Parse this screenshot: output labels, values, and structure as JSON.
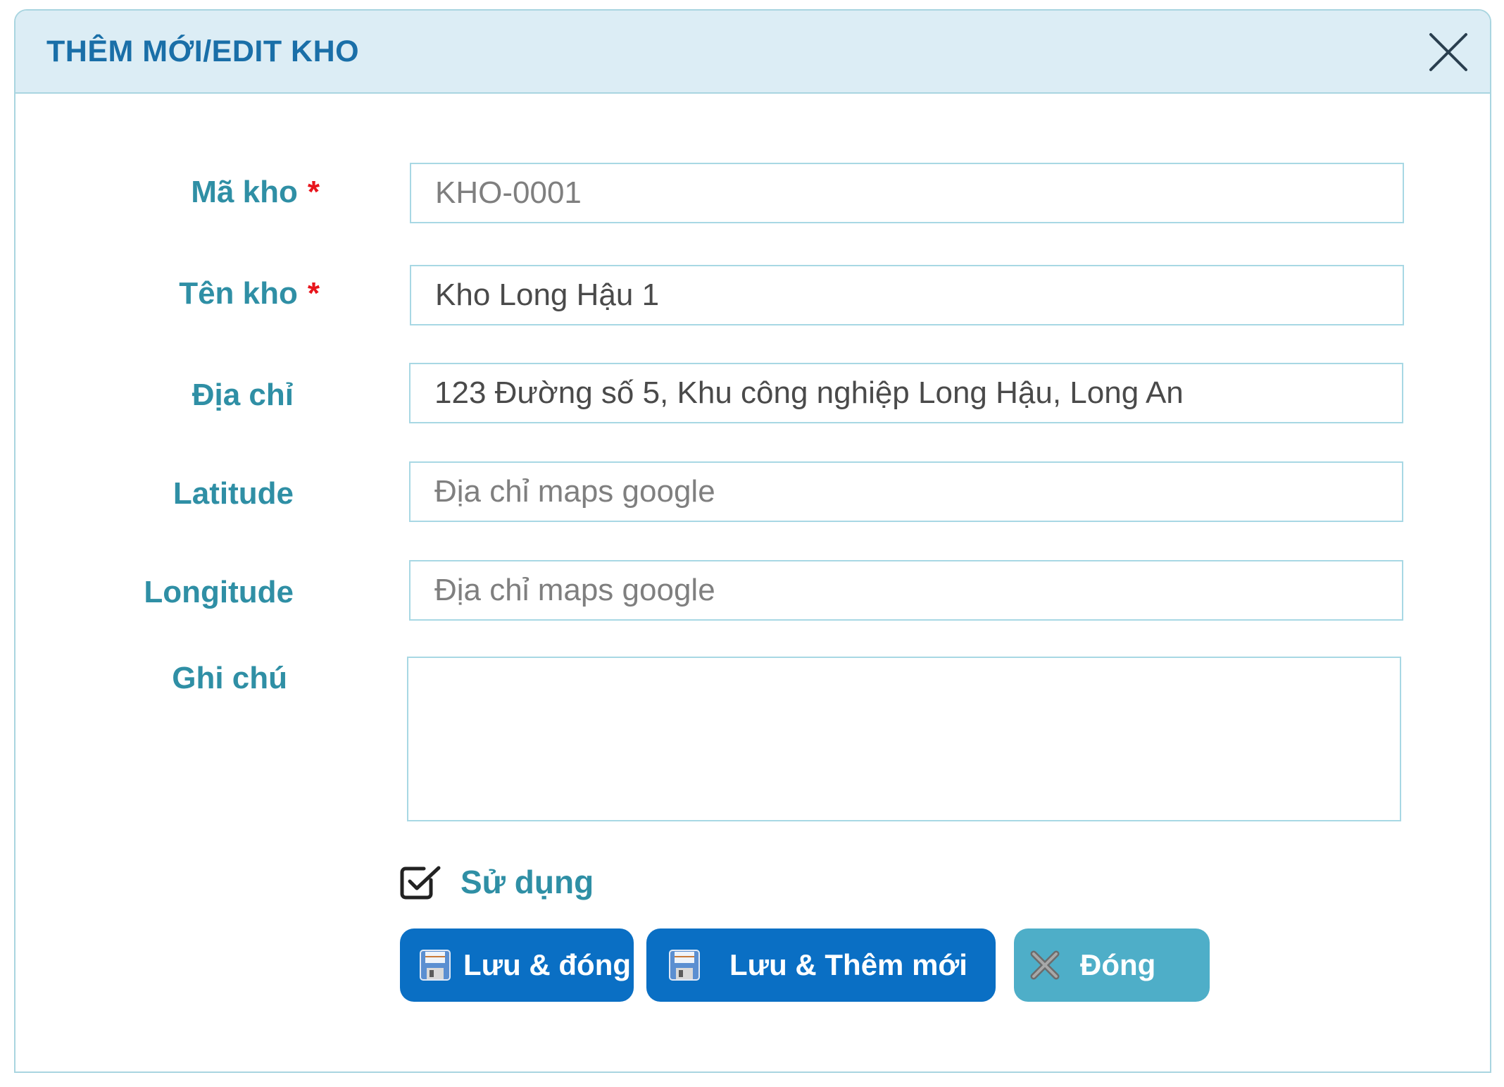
{
  "dialog": {
    "title": "THÊM MỚI/EDIT KHO",
    "close_icon": "close-icon"
  },
  "form": {
    "ma_kho": {
      "label": "Mã kho",
      "required_mark": "*",
      "value": "KHO-0001"
    },
    "ten_kho": {
      "label": "Tên kho",
      "required_mark": "*",
      "value": "Kho Long Hậu 1"
    },
    "dia_chi": {
      "label": "Địa chỉ",
      "value": "123 Đường số 5, Khu công nghiệp Long Hậu, Long An"
    },
    "latitude": {
      "label": "Latitude",
      "placeholder": "Địa chỉ maps google"
    },
    "longitude": {
      "label": "Longitude",
      "placeholder": "Địa chỉ maps google"
    },
    "ghi_chu": {
      "label": "Ghi chú",
      "value": ""
    },
    "su_dung": {
      "label": "Sử dụng",
      "checked": true,
      "icon": "checkbox-checked-icon"
    }
  },
  "buttons": {
    "save_close": {
      "label": "Lưu & đóng",
      "icon": "floppy-disk-icon"
    },
    "save_new": {
      "label": "Lưu & Thêm mới",
      "icon": "floppy-disk-icon"
    },
    "close": {
      "label": "Đóng",
      "icon": "x-icon"
    }
  },
  "colors": {
    "header_bg": "#dcedf5",
    "title": "#1a6fa8",
    "label": "#2f8fa5",
    "required": "#e8151c",
    "field_border": "#a8d8e4",
    "primary_button": "#0a6fc4",
    "secondary_button": "#4eaec8"
  }
}
